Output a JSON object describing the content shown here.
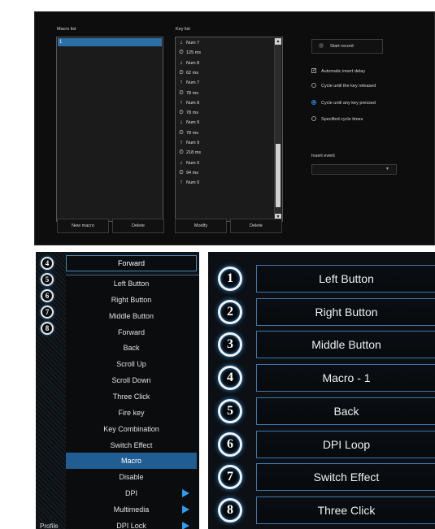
{
  "macro_editor": {
    "macro_list_label": "Macro list",
    "key_list_label": "Key list",
    "macro_items": [
      "1"
    ],
    "key_items": [
      {
        "icon": "arrow-down",
        "text": "Num 7"
      },
      {
        "icon": "clock",
        "text": "125 ms"
      },
      {
        "icon": "arrow-down",
        "text": "Num 8"
      },
      {
        "icon": "clock",
        "text": "62 ms"
      },
      {
        "icon": "arrow-up",
        "text": "Num 7"
      },
      {
        "icon": "clock",
        "text": "78 ms"
      },
      {
        "icon": "arrow-up",
        "text": "Num 8"
      },
      {
        "icon": "clock",
        "text": "78 ms"
      },
      {
        "icon": "arrow-down",
        "text": "Num 9"
      },
      {
        "icon": "clock",
        "text": "78 ms"
      },
      {
        "icon": "arrow-up",
        "text": "Num 9"
      },
      {
        "icon": "clock",
        "text": "218 ms"
      },
      {
        "icon": "arrow-down",
        "text": "Num 0"
      },
      {
        "icon": "clock",
        "text": "94 ms"
      },
      {
        "icon": "arrow-up",
        "text": "Num 0"
      }
    ],
    "buttons": {
      "new_macro": "New macro",
      "delete_macro": "Delete",
      "modify": "Modify",
      "delete_key": "Delete"
    },
    "start_record": "Start record",
    "auto_insert_delay": "Automatic insert delay",
    "cycle_options": [
      "Cycle until the key released",
      "Cycle until any key pressed",
      "Specified cycle times"
    ],
    "cycle_selected_index": 1,
    "insert_event_label": "Insert event",
    "insert_event_value": ""
  },
  "dropdown": {
    "numbers": [
      "4",
      "5",
      "6",
      "7",
      "8"
    ],
    "selected": "Forward",
    "items": [
      {
        "label": "Left Button"
      },
      {
        "label": "Right Button"
      },
      {
        "label": "Middle Button"
      },
      {
        "label": "Forward"
      },
      {
        "label": "Back"
      },
      {
        "label": "Scroll Up"
      },
      {
        "label": "Scroll Down"
      },
      {
        "label": "Three Click"
      },
      {
        "label": "Fire key"
      },
      {
        "label": "Key Combination"
      },
      {
        "label": "Switch Effect"
      },
      {
        "label": "Macro",
        "active": true
      },
      {
        "label": "Disable"
      },
      {
        "label": "DPI",
        "submenu": true
      },
      {
        "label": "Multimedia",
        "submenu": true
      },
      {
        "label": "DPI Lock",
        "submenu": true
      }
    ],
    "profile_label": "Profile",
    "accent": "#2f9bee"
  },
  "mapping": {
    "buttons": [
      {
        "num": "1",
        "label": "Left Button"
      },
      {
        "num": "2",
        "label": "Right Button"
      },
      {
        "num": "3",
        "label": "Middle Button"
      },
      {
        "num": "4",
        "label": "Macro - 1"
      },
      {
        "num": "5",
        "label": "Back"
      },
      {
        "num": "6",
        "label": "DPI Loop"
      },
      {
        "num": "7",
        "label": "Switch Effect"
      },
      {
        "num": "8",
        "label": "Three Click"
      }
    ]
  }
}
